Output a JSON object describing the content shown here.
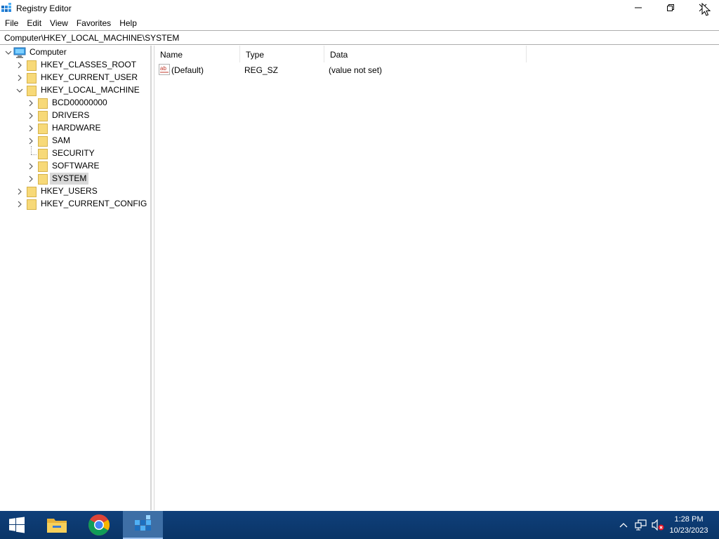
{
  "window": {
    "title": "Registry Editor",
    "icon": "regedit-icon",
    "controls": [
      "minimize-icon",
      "restore-icon",
      "close-icon"
    ]
  },
  "menu": [
    "File",
    "Edit",
    "View",
    "Favorites",
    "Help"
  ],
  "address": {
    "path": "Computer\\HKEY_LOCAL_MACHINE\\SYSTEM"
  },
  "tree": {
    "root": "Computer",
    "hives": [
      {
        "label": "HKEY_CLASSES_ROOT"
      },
      {
        "label": "HKEY_CURRENT_USER"
      },
      {
        "label": "HKEY_LOCAL_MACHINE"
      },
      {
        "label": "HKEY_USERS"
      },
      {
        "label": "HKEY_CURRENT_CONFIG"
      }
    ],
    "hklm_children": [
      {
        "label": "BCD00000000"
      },
      {
        "label": "DRIVERS"
      },
      {
        "label": "HARDWARE"
      },
      {
        "label": "SAM"
      },
      {
        "label": "SECURITY"
      },
      {
        "label": "SOFTWARE"
      },
      {
        "label": "SYSTEM"
      }
    ],
    "selected": "SYSTEM"
  },
  "list": {
    "columns": [
      "Name",
      "Type",
      "Data"
    ],
    "rows": [
      {
        "name": "(Default)",
        "type": "REG_SZ",
        "data": "(value not set)",
        "icon": "string-value-icon"
      }
    ]
  },
  "taskbar": {
    "items": [
      "start-icon",
      "file-explorer-icon",
      "chrome-icon",
      "regedit-icon"
    ],
    "active": "regedit-icon",
    "tray_icons": [
      "chevron-up-icon",
      "network-icon",
      "volume-muted-icon"
    ],
    "time": "1:28 PM",
    "date": "10/23/2023"
  },
  "colors": {
    "taskbar": "#0c3a70",
    "selection": "#d9d9d9",
    "folder": "#f7d978"
  }
}
